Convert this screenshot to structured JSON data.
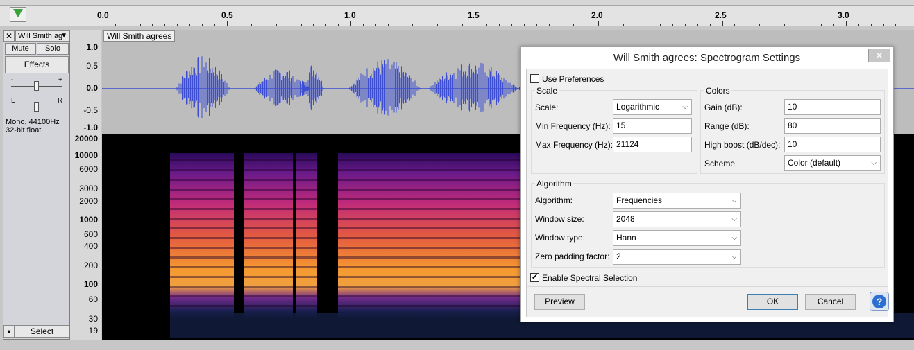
{
  "ruler": {
    "ticks": [
      "0.0",
      "0.5",
      "1.0",
      "1.5",
      "2.0",
      "2.5",
      "3.0"
    ]
  },
  "track": {
    "close": "✕",
    "name": "Will Smith ag",
    "menu_arrow": "▼",
    "title": "Will Smith agrees",
    "mute": "Mute",
    "solo": "Solo",
    "effects": "Effects",
    "gain_minus": "-",
    "gain_plus": "+",
    "pan_left": "L",
    "pan_right": "R",
    "format_line1": "Mono, 44100Hz",
    "format_line2": "32-bit float",
    "select": "Select",
    "collapse": "▲"
  },
  "wave_scale": [
    "1.0",
    "0.5",
    "0.0",
    "-0.5",
    "-1.0"
  ],
  "spec_scale": [
    "20000",
    "10000",
    "6000",
    "3000",
    "2000",
    "1000",
    "600",
    "400",
    "200",
    "100",
    "60",
    "30",
    "19"
  ],
  "dialog": {
    "title": "Will Smith agrees: Spectrogram Settings",
    "close": "✕",
    "use_preferences": "Use Preferences",
    "use_preferences_checked": false,
    "scale_group": "Scale",
    "scale_label": "Scale:",
    "scale_value": "Logarithmic",
    "min_freq_label": "Min Frequency (Hz):",
    "min_freq_value": "15",
    "max_freq_label": "Max Frequency (Hz):",
    "max_freq_value": "21124",
    "colors_group": "Colors",
    "gain_label": "Gain (dB):",
    "gain_value": "10",
    "range_label": "Range (dB):",
    "range_value": "80",
    "high_boost_label": "High boost (dB/dec):",
    "high_boost_value": "10",
    "scheme_label": "Scheme",
    "scheme_value": "Color (default)",
    "algorithm_group": "Algorithm",
    "algorithm_label": "Algorithm:",
    "algorithm_value": "Frequencies",
    "window_size_label": "Window size:",
    "window_size_value": "2048",
    "window_type_label": "Window type:",
    "window_type_value": "Hann",
    "zero_padding_label": "Zero padding factor:",
    "zero_padding_value": "2",
    "spectral_selection": "Enable Spectral Selection",
    "spectral_selection_checked": true,
    "preview": "Preview",
    "ok": "OK",
    "cancel": "Cancel",
    "help": "?"
  },
  "colors": {
    "waveform": "#3d4fd0",
    "dialog_bg": "#f0f0f0",
    "help_blue": "#2c6fd0"
  }
}
